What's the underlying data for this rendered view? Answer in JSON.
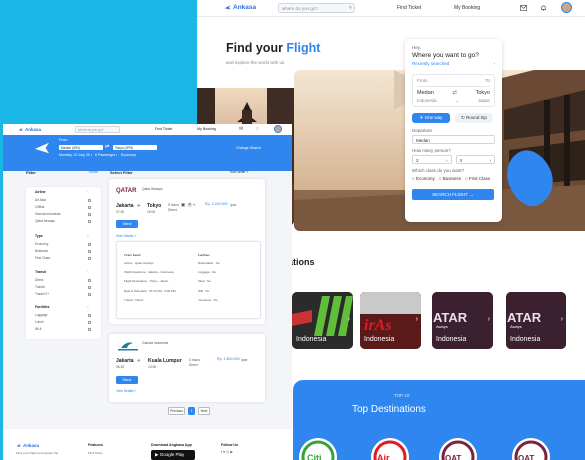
{
  "home": {
    "brand": "Ankasa",
    "search_placeholder": "where do you go?",
    "nav": [
      "Find Ticket",
      "My Booking"
    ],
    "hero_title_1": "Find your ",
    "hero_title_2": "Flight",
    "hero_sub": "and explore the world with us",
    "card": {
      "hey": "Hey,",
      "heading": "Where you want to go?",
      "recent": "Recently searched",
      "from_label": "From",
      "to_label": "To",
      "from_city": "Medan",
      "to_city": "Tokyo",
      "from_country": "Indonesia",
      "to_country": "Japan",
      "one_way": "One way",
      "round_trip": "Round trip",
      "departure_label": "Departure",
      "departure_value": "Medan",
      "persons_label": "How many person?",
      "adult": "2",
      "child": "4",
      "class_label": "Which class do you want?",
      "classes": [
        "Economy",
        "Business",
        "First Class"
      ],
      "search_button": "SEARCH FLIGHT"
    },
    "destinations_heading": "ations",
    "tiles": [
      {
        "name": "Indonesia",
        "label": ""
      },
      {
        "name": "Indonesia",
        "label": ""
      },
      {
        "name": "Indonesia",
        "label": "Aways"
      },
      {
        "name": "Indonesia",
        "label": "Aways"
      }
    ],
    "top_small": "TOP 10",
    "top_big": "Top Destinations",
    "colors": {
      "accent": "#2f86ef",
      "background": "#19b8e6"
    }
  },
  "results": {
    "brand": "Ankasa",
    "search_placeholder": "where do you go?",
    "nav": [
      "Find Ticket",
      "My Booking"
    ],
    "from_label": "From",
    "from_value": "Medan (IDN)",
    "to_value": "Tokyo (JPN)",
    "details": [
      "Monday, 20 July 20",
      "6 Passenger",
      "Economy"
    ],
    "change_search": "Change Search",
    "filter_title": "Filter",
    "reset": "Reset",
    "groups": [
      {
        "title": "Airline",
        "items": [
          "Air Asia",
          "Citilink",
          "Garuda Indonesia",
          "Qatar Airways"
        ]
      },
      {
        "title": "Type",
        "items": [
          "Economy",
          "Business",
          "First Class"
        ]
      },
      {
        "title": "Transit",
        "items": [
          "Direct",
          "Transit",
          "Transit 2+"
        ]
      },
      {
        "title": "Facilities",
        "items": [
          "Luggage",
          "Lunch",
          "Wi-fi"
        ]
      }
    ],
    "select_filter": "Select Filter",
    "sort_by": "Sort order",
    "flight1": {
      "airline": "Qatar Airways",
      "from": "Jakarta",
      "to": "Tokyo",
      "from_code": "07:20",
      "to_code": "15:00",
      "duration": "9 hours",
      "transit": "Direct",
      "price": "Rp. 3.200.000",
      "per": "/pax",
      "select": "Select",
      "hide": "Hide Details",
      "detail_title": "Ticket Detail",
      "detail_rows": [
        "Airline : Qatar Airways",
        "Flight Departure : Jakarta - Indonesia",
        "Flight Destination : Tokyo - Japan",
        "Date & Schedule : 07:20 AM - 3:00 PM",
        "Transit : Direct"
      ],
      "fac_title": "Facilities",
      "fac_rows": [
        "Refundable : No",
        "Luggage : No",
        "Meal : No",
        "Wifi : No",
        "Insurance : No"
      ]
    },
    "flight2": {
      "airline": "Garuda Indonesia",
      "from": "Jakarta",
      "to": "Kuala Lumpur",
      "from_code": "06:20",
      "to_code": "10:00",
      "duration": "3 hours",
      "transit": "Direct",
      "price": "Rp. 1.800.000",
      "per": "/pax",
      "select": "Select",
      "view": "View Details"
    },
    "pager": [
      "Previous",
      "1",
      "Next"
    ],
    "footer": {
      "brand": "Ankasa",
      "tagline": "Find your Flight and explore the",
      "features": "Features",
      "feature_item": "Find Ticket",
      "download": "Download Angkasa App",
      "google": "Google Play",
      "follow": "Follow Us",
      "social": "f  ♥  ◎  ▶"
    }
  }
}
